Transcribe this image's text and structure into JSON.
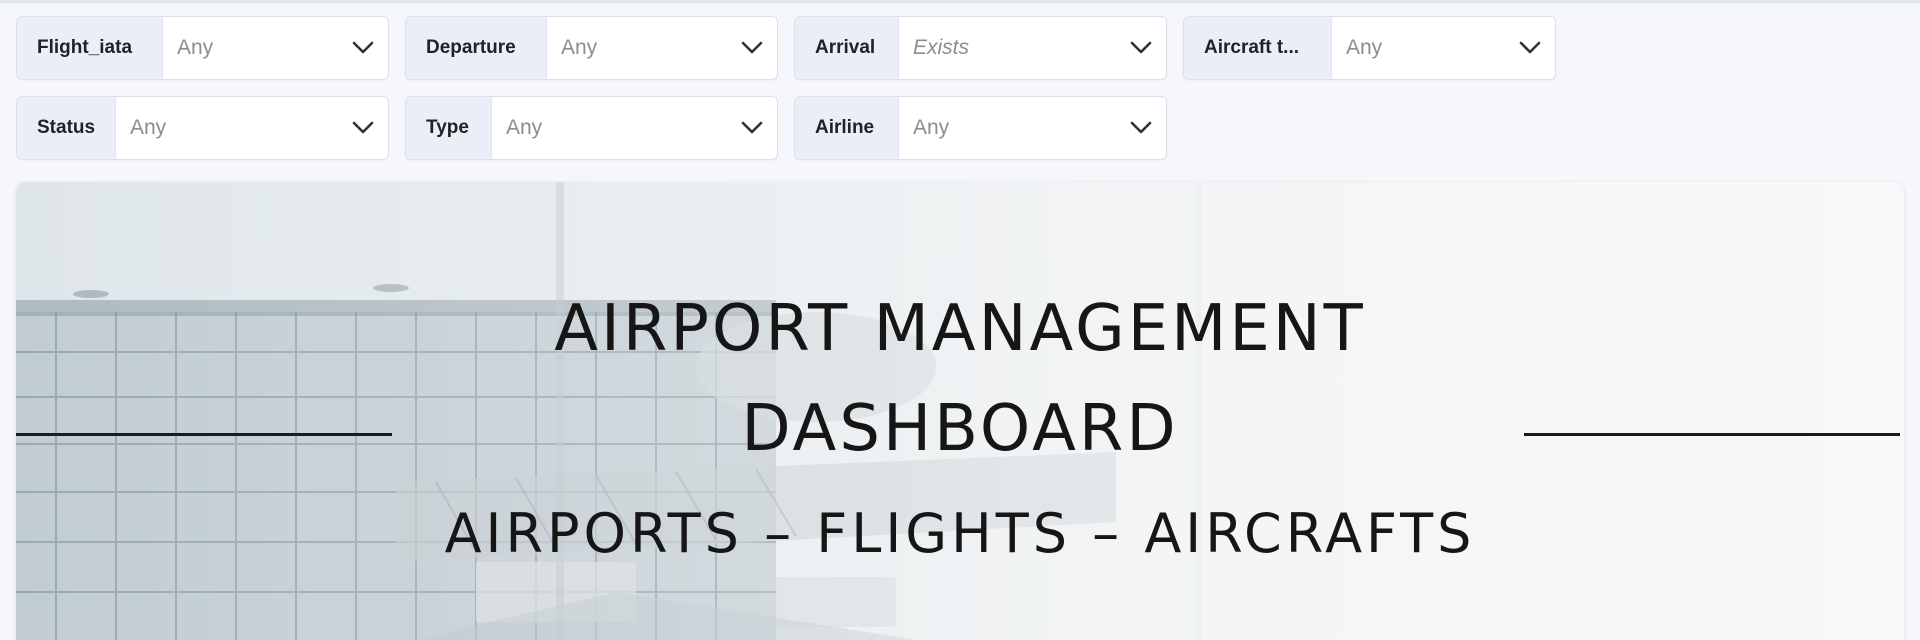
{
  "filters": [
    {
      "label": "Flight_iata",
      "value": "Any",
      "italic": false
    },
    {
      "label": "Departure",
      "value": "Any",
      "italic": false
    },
    {
      "label": "Arrival",
      "value": "Exists",
      "italic": true
    },
    {
      "label": "Aircraft t...",
      "value": "Any",
      "italic": false
    },
    {
      "label": "Status",
      "value": "Any",
      "italic": false
    },
    {
      "label": "Type",
      "value": "Any",
      "italic": false
    },
    {
      "label": "Airline",
      "value": "Any",
      "italic": false
    }
  ],
  "banner": {
    "title_line1": "AIRPORT MANAGEMENT",
    "title_line2": "DASHBOARD",
    "subtitle": "AIRPORTS – FLIGHTS – AIRCRAFTS",
    "background": "airport-terminal-photo"
  },
  "colors": {
    "page_bg": "#f6f7fc",
    "label_bg": "#eceef7",
    "title_text": "#161616"
  }
}
